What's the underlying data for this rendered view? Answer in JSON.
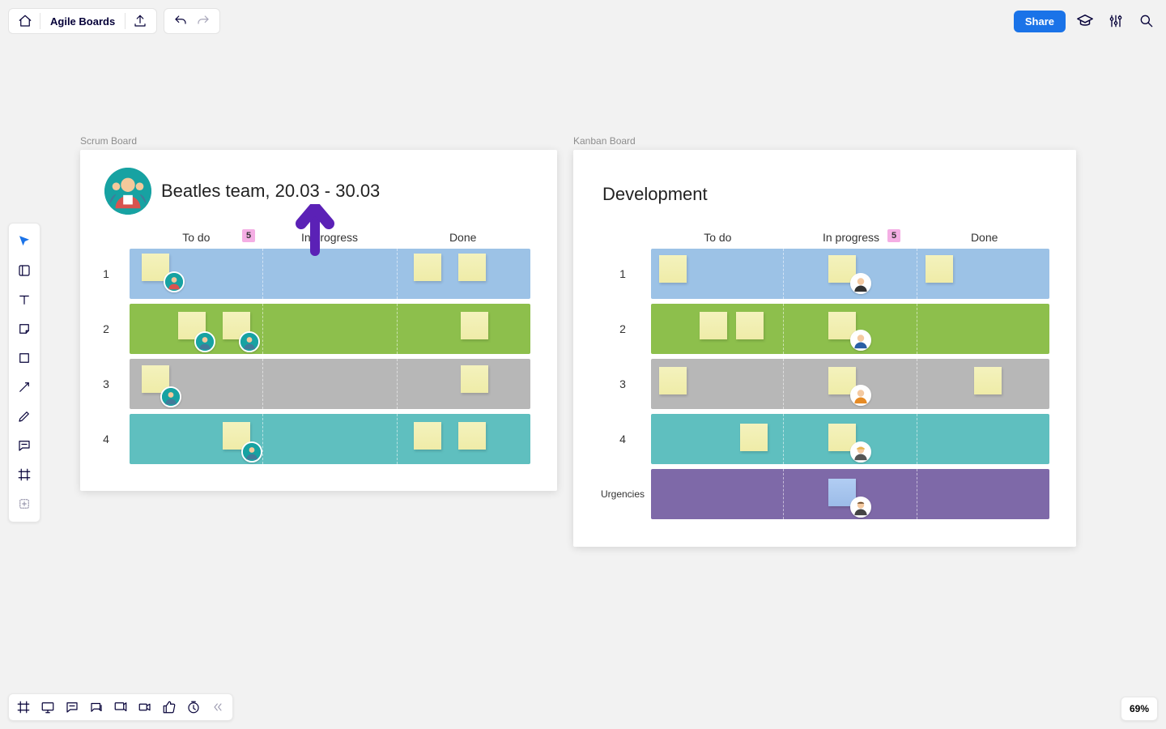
{
  "app_title": "Agile Boards",
  "share_label": "Share",
  "zoom_label": "69%",
  "frames": {
    "scrum": {
      "label": "Scrum Board",
      "title": "Beatles team, 20.03 - 30.03"
    },
    "kanban": {
      "label": "Kanban Board",
      "title": "Development"
    }
  },
  "columns": {
    "todo": "To do",
    "in_progress": "In progress",
    "done": "Done"
  },
  "wip_badge_scrum": "5",
  "wip_badge_kanban": "5",
  "scrum_rows": [
    "1",
    "2",
    "3",
    "4"
  ],
  "kanban_rows": [
    "1",
    "2",
    "3",
    "4",
    "Urgencies"
  ]
}
